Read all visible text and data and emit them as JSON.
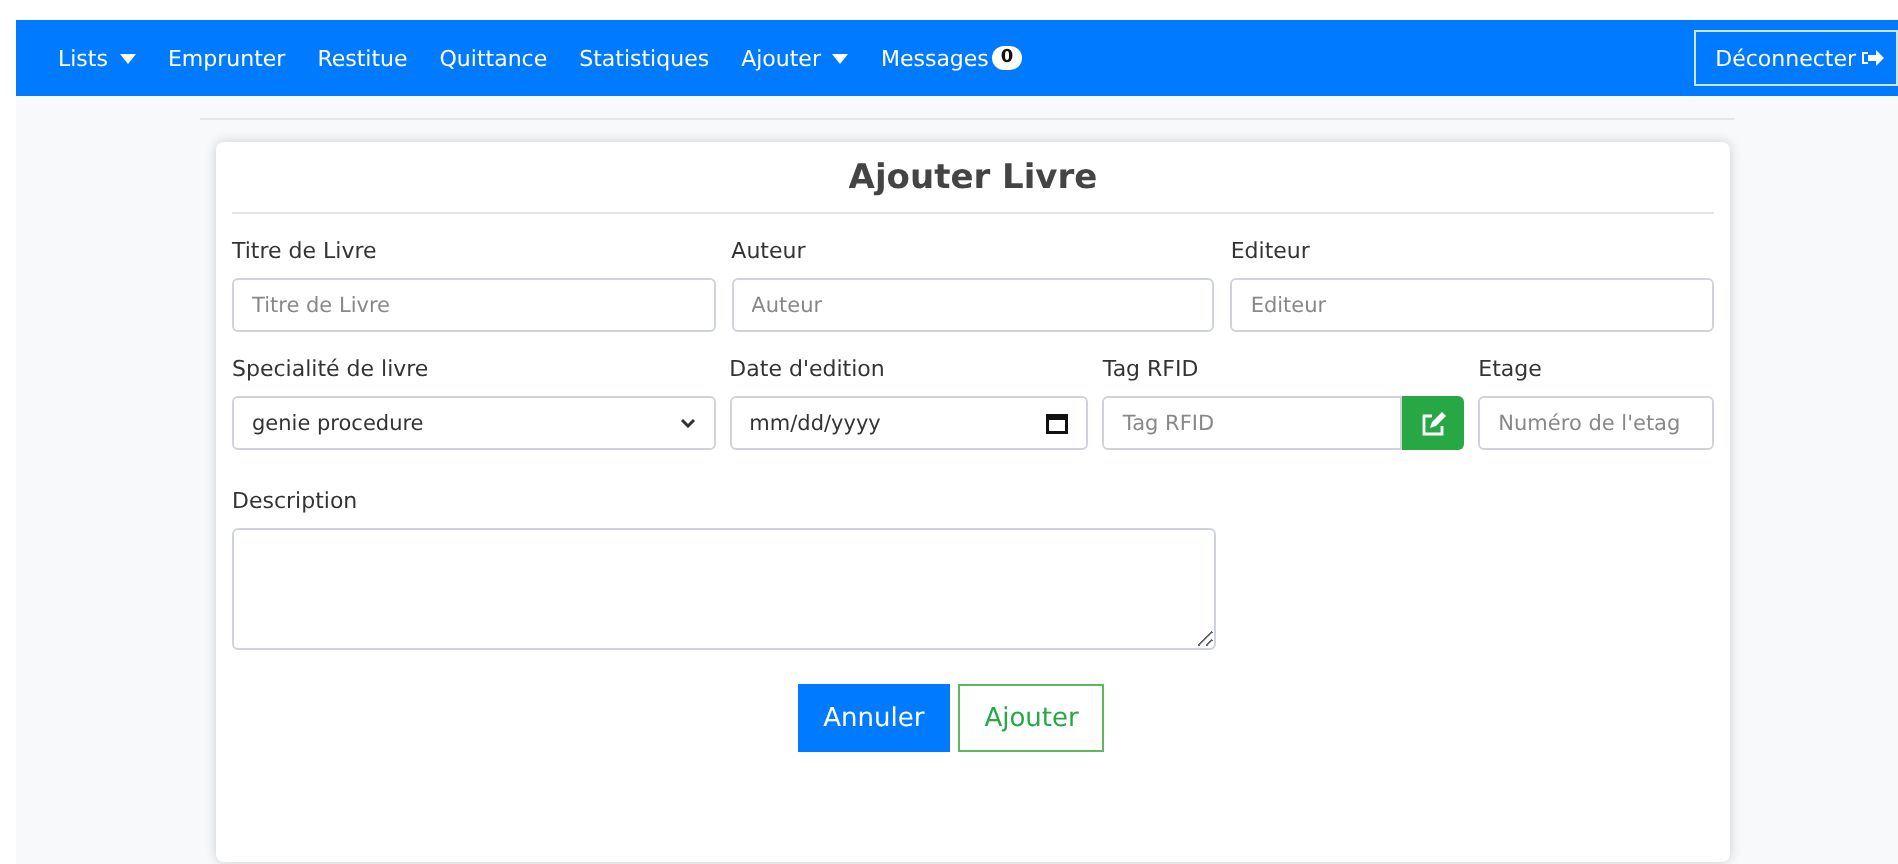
{
  "navbar": {
    "items": [
      {
        "label": "Lists",
        "kind": "dropdown"
      },
      {
        "label": "Emprunter",
        "kind": "link"
      },
      {
        "label": "Restitue",
        "kind": "link"
      },
      {
        "label": "Quittance",
        "kind": "link"
      },
      {
        "label": "Statistiques",
        "kind": "link"
      },
      {
        "label": "Ajouter",
        "kind": "dropdown"
      },
      {
        "label": "Messages",
        "kind": "badge",
        "badge": "0"
      }
    ],
    "logout": {
      "label": "Déconnecter"
    }
  },
  "form": {
    "title": "Ajouter Livre",
    "rows": [
      [
        {
          "label": "Titre de Livre",
          "kind": "text",
          "placeholder": "Titre de Livre"
        },
        {
          "label": "Auteur",
          "kind": "text",
          "placeholder": "Auteur"
        },
        {
          "label": "Editeur",
          "kind": "text",
          "placeholder": "Editeur"
        }
      ],
      [
        {
          "label": "Specialité de livre",
          "kind": "select",
          "value": "genie procedure"
        },
        {
          "label": "Date d'edition",
          "kind": "date",
          "placeholder": "mm/dd/yyyy"
        },
        {
          "label": "Tag RFID",
          "kind": "button-input",
          "placeholder": "Tag RFID"
        },
        {
          "label": "Etage",
          "kind": "text",
          "placeholder": "Numéro de l'etag"
        }
      ]
    ],
    "description": {
      "label": "Description"
    },
    "buttons": [
      {
        "label": "Annuler",
        "kind": "primary"
      },
      {
        "label": "Ajouter",
        "kind": "outline"
      }
    ]
  }
}
